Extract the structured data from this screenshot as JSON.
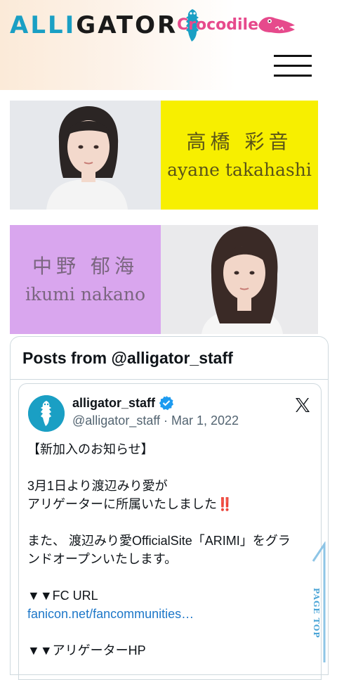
{
  "header": {
    "logo_alligator_prefix": "ALLI",
    "logo_alligator_rest": "GATOR",
    "logo_crocodile": "Crocodile",
    "accent_blue": "#1a9fc4",
    "accent_pink": "#e64a8c"
  },
  "menu": {
    "icon": "hamburger-menu-icon"
  },
  "members": [
    {
      "name_jp": "高橋 彩音",
      "name_en": "ayane takahashi",
      "color": "#f7ef00"
    },
    {
      "name_jp": "中野 郁海",
      "name_en": "ikumi nakano",
      "color": "#d9a6ee"
    }
  ],
  "twitter": {
    "title": "Posts from @alligator_staff",
    "tweet": {
      "user": "alligator_staff",
      "handle_date": "@alligator_staff · Mar 1, 2022",
      "line1": "【新加入のお知らせ】",
      "line2": "3月1日より渡辺みり愛が",
      "line3": "アリゲーターに所属いたしました",
      "line3_emoji": "‼️",
      "line4": "また、 渡辺みり愛OfficialSite「ARIMI」をグラ",
      "line5": "ンドオープンいたします。",
      "line6": "▼▼FC URL",
      "link": "fanicon.net/fancommunities…",
      "line7": "▼▼アリゲーターHP"
    }
  },
  "page_top": {
    "label": "PAGE TOP"
  }
}
